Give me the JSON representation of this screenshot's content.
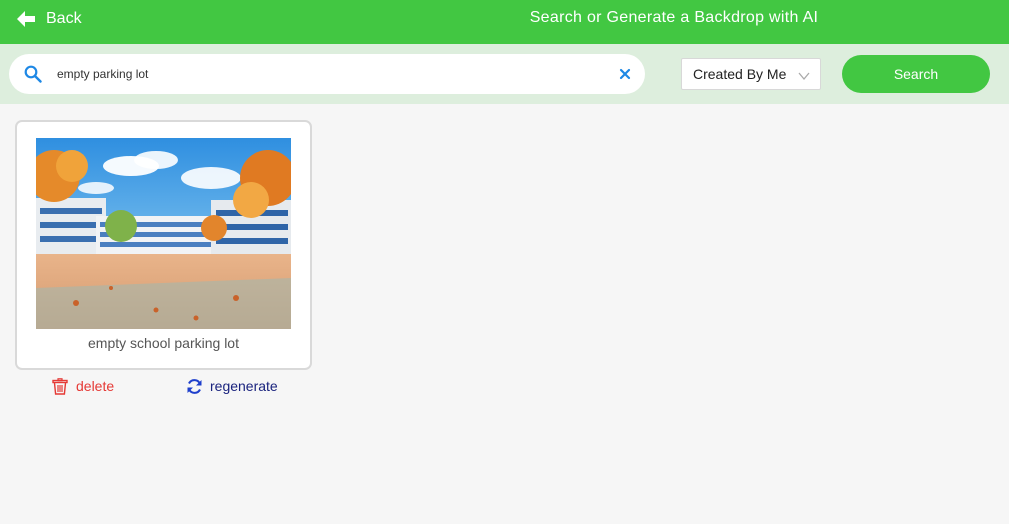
{
  "header": {
    "back_label": "Back",
    "title": "Search or Generate a Backdrop with AI",
    "back_icon": "arrow-left-icon"
  },
  "search": {
    "value": "empty parking lot",
    "search_icon": "search-icon",
    "clear_icon": "close-icon"
  },
  "filter": {
    "selected": "Created By Me",
    "chevron_icon": "chevron-down-icon"
  },
  "search_button": {
    "label": "Search"
  },
  "results": [
    {
      "caption": "empty school parking lot",
      "delete_label": "delete",
      "regenerate_label": "regenerate"
    }
  ],
  "colors": {
    "brand_green": "#42c742",
    "search_row_bg": "#ddeedd",
    "page_bg": "#f6f6f6",
    "delete_red": "#e53935",
    "regenerate_navy": "#1a237e",
    "search_icon_blue": "#1e88e5"
  }
}
